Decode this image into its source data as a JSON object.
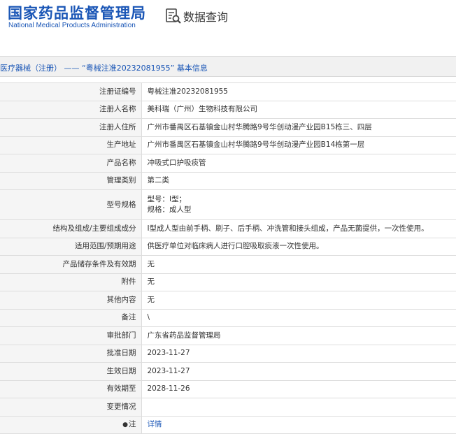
{
  "header": {
    "logo_cn": "国家药品监督管理局",
    "logo_en": "National Medical Products Administration",
    "query_label": "数据查询",
    "query_icon": "data-search-icon"
  },
  "title": "医疗器械（注册） —— “粤械注准20232081955” 基本信息",
  "rows": [
    {
      "label": "注册证编号",
      "value": "粤械注准20232081955"
    },
    {
      "label": "注册人名称",
      "value": "美科瑞（广州）生物科技有限公司"
    },
    {
      "label": "注册人住所",
      "value": "广州市番禺区石基镇金山村华腾路9号华创动漫产业园B15栋三、四层"
    },
    {
      "label": "生产地址",
      "value": "广州市番禺区石基镇金山村华腾路9号华创动漫产业园B14栋第一层"
    },
    {
      "label": "产品名称",
      "value": "冲吸式口护吸痰管"
    },
    {
      "label": "管理类别",
      "value": "第二类"
    },
    {
      "label": "型号规格",
      "value_line1": "型号：Ⅰ型；",
      "value_line2": "规格：成人型"
    },
    {
      "label": "结构及组成/主要组成成分",
      "value": "Ⅰ型成人型由前手柄、刷子、后手柄、冲洗管和接头组成，产品无菌提供，一次性使用。"
    },
    {
      "label": "适用范围/预期用途",
      "value": "供医疗单位对临床病人进行口腔吸取痰液一次性使用。"
    },
    {
      "label": "产品储存条件及有效期",
      "value": "无"
    },
    {
      "label": "附件",
      "value": "无"
    },
    {
      "label": "其他内容",
      "value": "无"
    },
    {
      "label": "备注",
      "value": "\\"
    },
    {
      "label": "审批部门",
      "value": "广东省药品监督管理局"
    },
    {
      "label": "批准日期",
      "value": "2023-11-27"
    },
    {
      "label": "生效日期",
      "value": "2023-11-27"
    },
    {
      "label": "有效期至",
      "value": "2028-11-26"
    },
    {
      "label": "变更情况",
      "value": ""
    },
    {
      "label": "注",
      "value": "详情",
      "label_icon": "location-pin-icon"
    }
  ]
}
